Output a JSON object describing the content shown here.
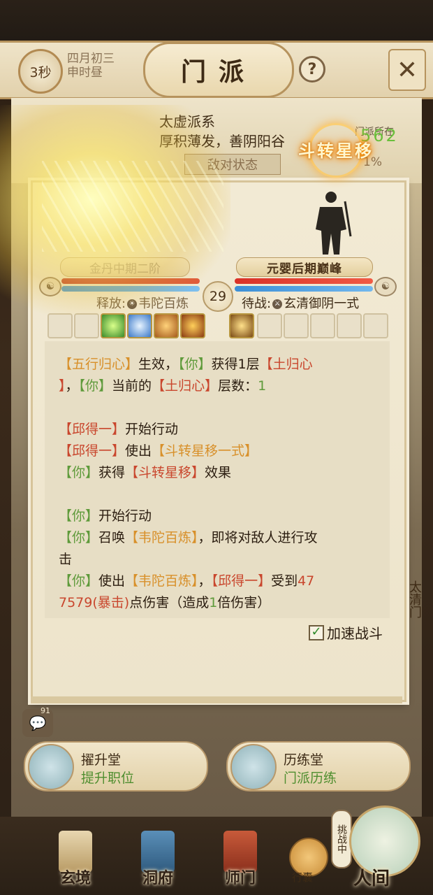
{
  "header": {
    "timer": "3秒",
    "date_line1": "四月初三",
    "date_line2": "申时昼",
    "title": "门派",
    "help_icon": "question-icon",
    "close_icon": "close-icon"
  },
  "sect": {
    "name": "太虚派系",
    "desc": "厚积薄发，善阴阳谷",
    "hostile": "敌对状态",
    "percent": "1%",
    "right_tag": "门派所在",
    "digits": "562"
  },
  "skill_effect": {
    "name": "斗转星移"
  },
  "battle": {
    "left_realm": "金丹中期二阶",
    "right_realm": "元婴后期巅峰",
    "round": "29",
    "release_label": "释放:",
    "release_value": "韦陀百炼",
    "standby_label": "待战:",
    "standby_value": "玄清御阴一式",
    "colors": {
      "hp": "#d93127",
      "mp": "#3c8fd6",
      "green": "#5e9a3a",
      "orange": "#d8902a",
      "red": "#c9462d"
    }
  },
  "log": {
    "l1": {
      "a": "【五行归心】",
      "b": "生效，",
      "c": "【你】",
      "d": "获得1层",
      "e": "【土归心"
    },
    "l2": {
      "a": "】",
      "b": "，",
      "c": "【你】",
      "d": "当前的",
      "e": "【土归心】",
      "f": "层数：",
      "g": "1"
    },
    "l3": {
      "a": "【邱得一】",
      "b": "开始行动"
    },
    "l4": {
      "a": "【邱得一】",
      "b": "使出",
      "c": "【斗转星移一式】"
    },
    "l5": {
      "a": "【你】",
      "b": "获得",
      "c": "【斗转星移】",
      "d": "效果"
    },
    "l6": {
      "a": "【你】",
      "b": "开始行动"
    },
    "l7": {
      "a": "【你】",
      "b": "召唤",
      "c": "【韦陀百炼】",
      "d": "，即将对敌人进行攻"
    },
    "l8": {
      "a": "击"
    },
    "l9": {
      "a": "【你】",
      "b": "使出",
      "c": "【韦陀百炼】",
      "d": "，",
      "e": "【邱得一】",
      "f": "受到",
      "g": "47"
    },
    "l10": {
      "a": "7579(暴击)",
      "b": "点伤害（造成",
      "c": "1",
      "d": "倍伤害）"
    }
  },
  "accelerate_label": "加速战斗",
  "side_gate": "太清门",
  "chat": {
    "badge": "91",
    "icon": "chat-icon"
  },
  "halls": [
    {
      "title": "擢升堂",
      "sub": "提升职位"
    },
    {
      "title": "历练堂",
      "sub": "门派历练"
    }
  ],
  "nav": {
    "items": [
      "玄境",
      "洞府",
      "师门"
    ],
    "bag": "行囊",
    "challenge": "挑战中",
    "world": "人间"
  }
}
